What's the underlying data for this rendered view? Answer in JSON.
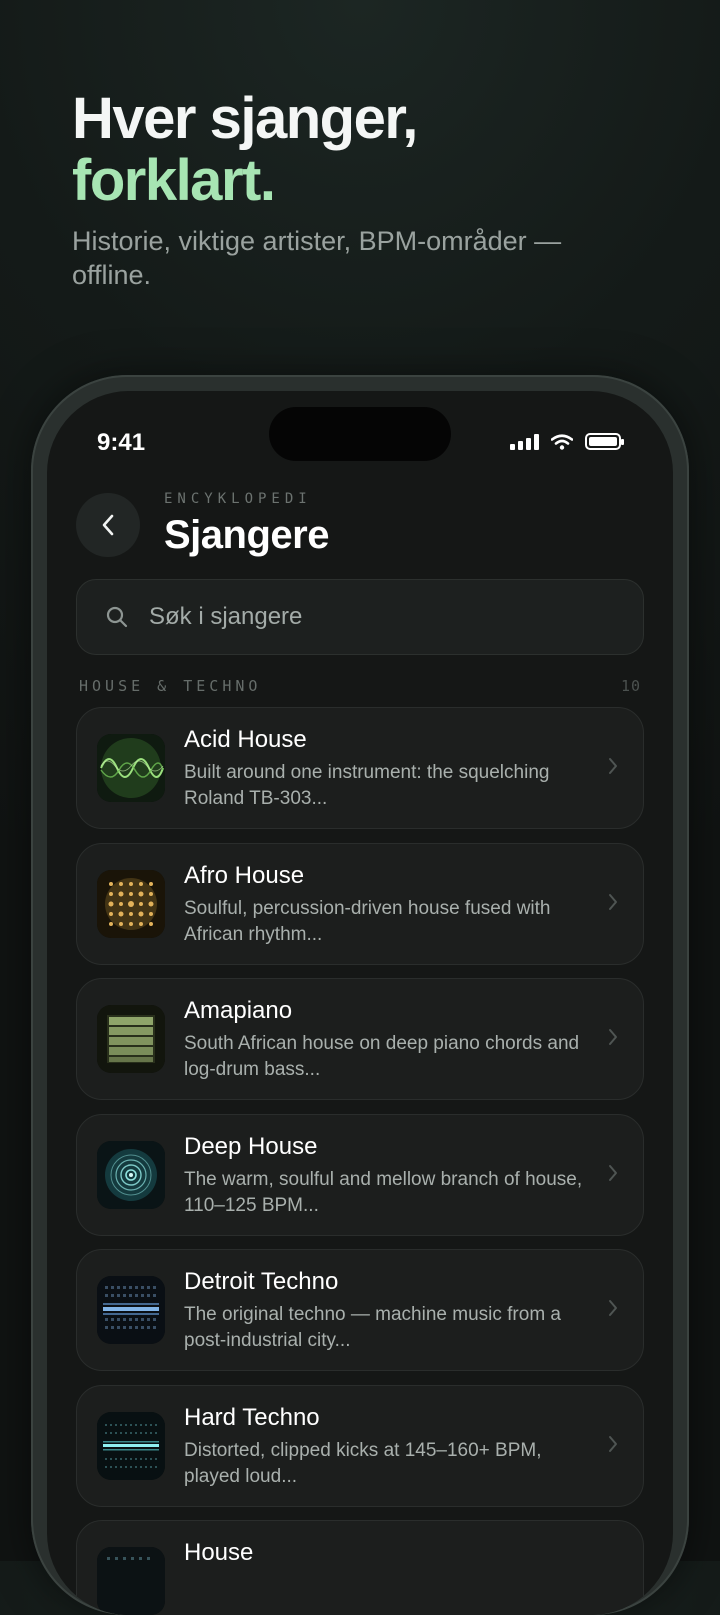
{
  "promo": {
    "title_line1": "Hver sjanger,",
    "title_line2": "forklart.",
    "subtitle": "Historie, viktige artister, BPM-områder — offline."
  },
  "status_bar": {
    "time": "9:41"
  },
  "header": {
    "overline": "ENCYKLOPEDI",
    "title": "Sjangere",
    "back_icon": "chevron-left-icon"
  },
  "search": {
    "placeholder": "Søk i sjangere",
    "icon": "search-icon"
  },
  "section": {
    "label": "HOUSE & TECHNO",
    "count": "10"
  },
  "genres": [
    {
      "title": "Acid House",
      "description": "Built around one instrument: the squelching Roland TB-303...",
      "thumb": "acid-wave"
    },
    {
      "title": "Afro House",
      "description": "Soulful, percussion-driven house fused with African rhythm...",
      "thumb": "afro-dots"
    },
    {
      "title": "Amapiano",
      "description": "South African house on deep piano chords and log-drum bass...",
      "thumb": "amapiano-bars"
    },
    {
      "title": "Deep House",
      "description": "The warm, soulful and mellow branch of house, 110–125 BPM...",
      "thumb": "deep-rings"
    },
    {
      "title": "Detroit Techno",
      "description": "The original techno — machine music from a post-industrial city...",
      "thumb": "detroit-grid"
    },
    {
      "title": "Hard Techno",
      "description": "Distorted, clipped kicks at 145–160+ BPM, played loud...",
      "thumb": "hard-grid"
    },
    {
      "title": "House",
      "description": "",
      "thumb": "house-grid"
    }
  ],
  "colors": {
    "accent": "#a7e5b3",
    "background": "#151716",
    "card": "#1c1e1d"
  }
}
